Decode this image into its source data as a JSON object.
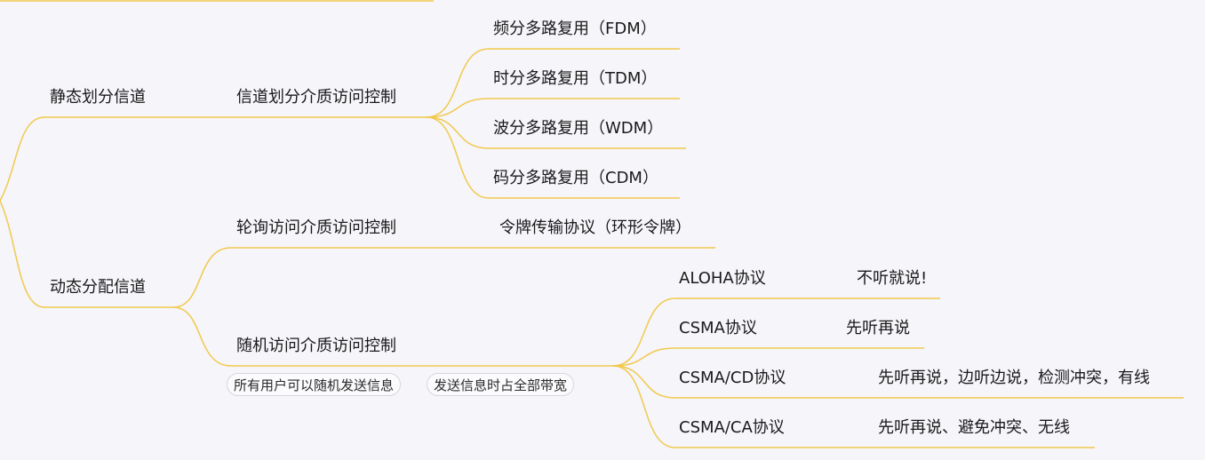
{
  "colors": {
    "branch_line": "#f2c94c",
    "background": "#f5f5fa",
    "text": "#1a1a1a",
    "tag_border": "#d6d6dc"
  },
  "nodes": {
    "static": "静态划分信道",
    "dynamic": "动态分配信道",
    "channel_division": "信道划分介质访问控制",
    "fdm": "频分多路复用（FDM）",
    "tdm": "时分多路复用（TDM）",
    "wdm": "波分多路复用（WDM）",
    "cdm": "码分多路复用（CDM）",
    "polling": "轮询访问介质访问控制",
    "token": "令牌传输协议（环形令牌）",
    "random": "随机访问介质访问控制",
    "aloha": "ALOHA协议",
    "aloha_desc": "不听就说!",
    "csma": "CSMA协议",
    "csma_desc": "先听再说",
    "csmacd": "CSMA/CD协议",
    "csmacd_desc": "先听再说，边听边说，检测冲突，有线",
    "csmaca": "CSMA/CA协议",
    "csmaca_desc": "先听再说、避免冲突、无线"
  },
  "tags": {
    "random_tag_1": "所有用户可以随机发送信息",
    "random_tag_2": "发送信息时占全部带宽"
  }
}
